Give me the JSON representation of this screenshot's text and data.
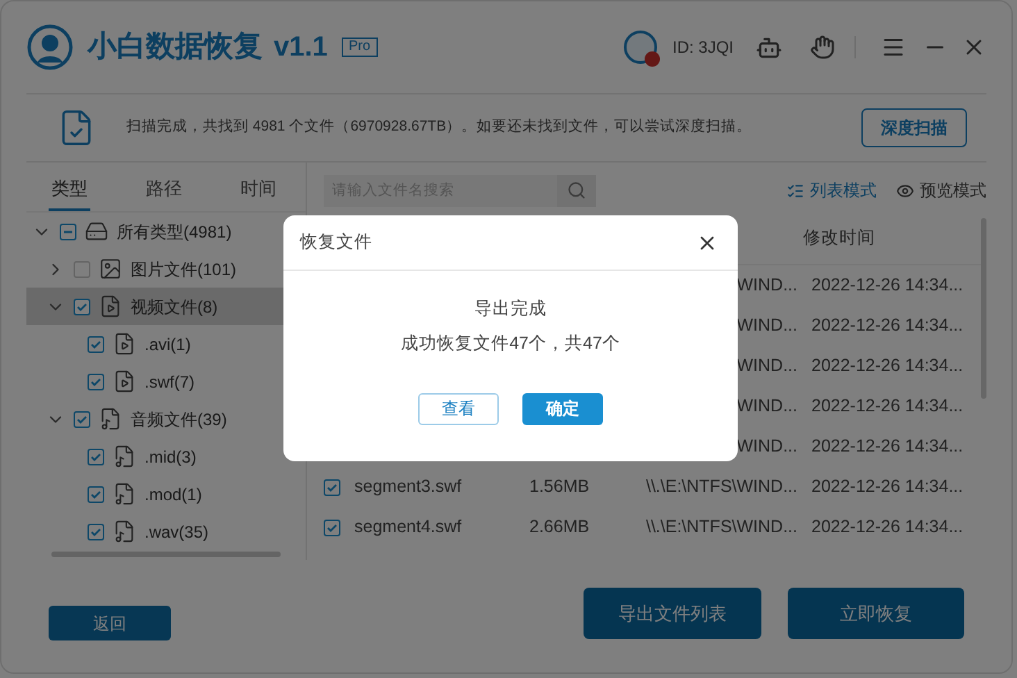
{
  "app": {
    "title": "小白数据恢复",
    "version": "v1.1",
    "edition": "Pro",
    "user_id": "ID: 3JQI"
  },
  "scan_summary": {
    "message": "扫描完成，共找到 4981 个文件（6970928.67TB）。如要还未找到文件，可以尝试深度扫描。",
    "deep_scan_button": "深度扫描"
  },
  "filter_tabs": [
    {
      "label": "类型",
      "selected": true
    },
    {
      "label": "路径",
      "selected": false
    },
    {
      "label": "时间",
      "selected": false
    }
  ],
  "search": {
    "placeholder": "请输入文件名搜索"
  },
  "view_modes": [
    {
      "label": "列表模式",
      "selected": true
    },
    {
      "label": "预览模式",
      "selected": false
    }
  ],
  "tree": [
    {
      "label": "所有类型(4981)",
      "kind": "drive",
      "checked": false,
      "indeterminate": true,
      "expanded": true,
      "selected": false,
      "children": [
        {
          "label": "图片文件(101)",
          "kind": "image",
          "checked": false,
          "indeterminate": false,
          "expanded": false,
          "selected": false
        },
        {
          "label": "视频文件(8)",
          "kind": "video",
          "checked": true,
          "indeterminate": false,
          "expanded": true,
          "selected": true,
          "children": [
            {
              "label": ".avi(1)",
              "kind": "video",
              "checked": true,
              "indeterminate": false,
              "selected": false
            },
            {
              "label": ".swf(7)",
              "kind": "video",
              "checked": true,
              "indeterminate": false,
              "selected": false
            }
          ]
        },
        {
          "label": "音频文件(39)",
          "kind": "audio",
          "checked": true,
          "indeterminate": false,
          "expanded": true,
          "selected": false,
          "children": [
            {
              "label": ".mid(3)",
              "kind": "audio",
              "checked": true,
              "indeterminate": false,
              "selected": false
            },
            {
              "label": ".mod(1)",
              "kind": "audio",
              "checked": true,
              "indeterminate": false,
              "selected": false
            },
            {
              "label": ".wav(35)",
              "kind": "audio",
              "checked": true,
              "indeterminate": false,
              "selected": false
            }
          ]
        }
      ]
    }
  ],
  "table": {
    "columns": [
      {
        "label": "修改时间"
      }
    ],
    "rows": [
      {
        "kind": "covered",
        "path": "WIND...",
        "modified": "2022-12-26 14:34..."
      },
      {
        "kind": "covered",
        "path": "WIND...",
        "modified": "2022-12-26 14:34..."
      },
      {
        "kind": "covered",
        "path": "WIND...",
        "modified": "2022-12-26 14:34..."
      },
      {
        "kind": "covered",
        "path": "WIND...",
        "modified": "2022-12-26 14:34..."
      },
      {
        "kind": "covered",
        "path": "WIND...",
        "modified": "2022-12-26 14:34..."
      },
      {
        "kind": "full",
        "checked": true,
        "name": "segment3.swf",
        "size": "1.56MB",
        "path": "\\\\.\\E:\\NTFS\\WIND...",
        "modified": "2022-12-26 14:34..."
      },
      {
        "kind": "full",
        "checked": true,
        "name": "segment4.swf",
        "size": "2.66MB",
        "path": "\\\\.\\E:\\NTFS\\WIND...",
        "modified": "2022-12-26 14:34..."
      }
    ]
  },
  "footer_buttons": {
    "back": "返回",
    "export_list": "导出文件列表",
    "recover_now": "立即恢复"
  },
  "dialog": {
    "title": "恢复文件",
    "heading": "导出完成",
    "message": "成功恢复文件47个，共47个",
    "buttons": [
      {
        "label": "查看",
        "kind": "outline"
      },
      {
        "label": "确定",
        "kind": "primary"
      }
    ]
  }
}
